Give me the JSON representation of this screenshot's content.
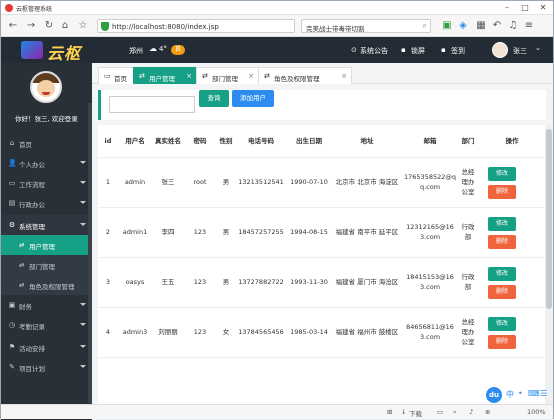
{
  "browser": {
    "window_title": "云枢管理系统",
    "url": "http://localhost:8080/index.jsp",
    "search_text": "完美战士带毒带切割",
    "search_icon": "magnifier-icon"
  },
  "header": {
    "logo_text": "云枢",
    "city": "郑州",
    "temperature": "4°",
    "weather_badge": "良",
    "notice": "系统公告",
    "lock": "锁屏",
    "signin": "签到",
    "user": "张三"
  },
  "sidebar": {
    "greeting": "你好！张三, 欢迎登录",
    "items": [
      {
        "icon": "⌂",
        "label": "首页",
        "arrow": false
      },
      {
        "icon": "👤",
        "label": "个人办公",
        "arrow": true
      },
      {
        "icon": "▭",
        "label": "工作流程",
        "arrow": true
      },
      {
        "icon": "▤",
        "label": "行政办公",
        "arrow": true
      },
      {
        "icon": "⚙",
        "label": "系统管理",
        "arrow": true
      }
    ],
    "sub_items": [
      {
        "icon": "⇄",
        "label": "用户管理"
      },
      {
        "icon": "⇄",
        "label": "部门管理"
      },
      {
        "icon": "⇄",
        "label": "角色及权限管理"
      }
    ],
    "items2": [
      {
        "icon": "▣",
        "label": "财务",
        "arrow": true
      },
      {
        "icon": "◷",
        "label": "考勤记录",
        "arrow": true
      },
      {
        "icon": "⚑",
        "label": "活动安排",
        "arrow": true
      },
      {
        "icon": "✎",
        "label": "项目计划",
        "arrow": true
      }
    ]
  },
  "tabs": [
    {
      "icon": "▭",
      "label": "首页"
    },
    {
      "icon": "⇄",
      "label": "用户管理"
    },
    {
      "icon": "⇄",
      "label": "部门管理"
    },
    {
      "icon": "⇄",
      "label": "角色及权限管理"
    }
  ],
  "toolbar": {
    "search_placeholder": "",
    "query_label": "查询",
    "add_label": "添加用户"
  },
  "table": {
    "headers": [
      "id",
      "用户名",
      "真实姓名",
      "密码",
      "性别",
      "电话号码",
      "出生日期",
      "地址",
      "邮箱",
      "部门",
      "操作"
    ],
    "edit_label": "修改",
    "delete_label": "删除",
    "rows": [
      [
        "1",
        "admin",
        "张三",
        "root",
        "男",
        "13213512541",
        "1990-07-10",
        "北京市 北京市 海淀区",
        "1765358522@qq.com",
        "总经理办公室"
      ],
      [
        "2",
        "admin1",
        "李四",
        "123",
        "男",
        "18457257255",
        "1994-08-15",
        "福建省 南平市 延平区",
        "12312165@163.com",
        "行政部"
      ],
      [
        "3",
        "oasys",
        "王五",
        "123",
        "男",
        "13727882722",
        "1993-11-30",
        "福建省 厦门市 海沧区",
        "18415153@163.com",
        "行政部"
      ],
      [
        "4",
        "admin3",
        "刘丽丽",
        "123",
        "女",
        "13784565456",
        "1985-03-14",
        "福建省 福州市 鼓楼区",
        "84656811@163.com",
        "总经理办公室"
      ]
    ]
  },
  "statusbar": {
    "download": "下载",
    "zoom": "100%"
  },
  "colors": {
    "accent": "#16a085",
    "danger": "#f0643b",
    "sidebar": "#2a3038",
    "header": "#232b34"
  }
}
